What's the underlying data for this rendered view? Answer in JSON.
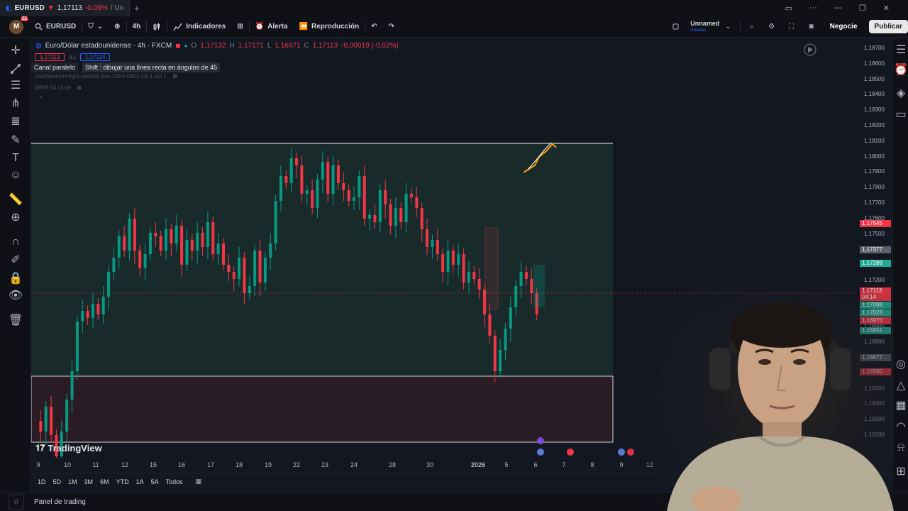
{
  "tab": {
    "symbol": "EURUSD",
    "price": "1,17113",
    "change": "-0.09%",
    "rest": "/ Un"
  },
  "toolbar": {
    "avatar_letter": "M",
    "avatar_badge": "11",
    "symbol": "EURUSD",
    "interval": "4h",
    "indicators_label": "Indicadores",
    "alert_label": "Alerta",
    "replay_label": "Reproducción",
    "layout_name": "Unnamed",
    "layout_status": "Guardar",
    "trade_label": "Negocie",
    "publish_label": "Publicar"
  },
  "legend": {
    "title": "Euro/Dólar estadounidense · 4h · FXCM",
    "o_label": "O",
    "o_value": "1,17132",
    "h_label": "H",
    "h_value": "1,17171",
    "l_label": "L",
    "l_value": "1,16971",
    "c_label": "C",
    "c_value": "1,17113",
    "change": "-0,00019 (-0,02%)",
    "sell_price": "1,17113",
    "spread": "0,1",
    "buy_price": "1,17114",
    "indicator_1": "AsiaSessionHighLowMidLines 0300-0800 sol 1 sol 1",
    "indicator_2": "WMA 14 close"
  },
  "tooltip": {
    "tool_name": "Canal paralelo",
    "hint": "Shift : dibujar una línea recta en ángulos de 45"
  },
  "price_axis": {
    "ticks": [
      "1,18700",
      "1,18600",
      "1,18500",
      "1,18400",
      "1,18300",
      "1,18200",
      "1,18100",
      "1,18000",
      "1,17900",
      "1,17800",
      "1,17700",
      "1,17600",
      "1,17500",
      "1,17400",
      "1,17300",
      "1,17200",
      "1,17100",
      "1,17000",
      "1,16900",
      "1,16800",
      "1,16700",
      "1,16600",
      "1,16500",
      "1,16400",
      "1,16300",
      "1,16200"
    ],
    "labels": [
      {
        "text": "1,17545",
        "color": "#f23645"
      },
      {
        "text": "1,17377",
        "color": "#5d606b"
      },
      {
        "text": "1,17289",
        "color": "#22ab94"
      },
      {
        "text": "1,17113",
        "color": "#f23645"
      },
      {
        "text": "04:14",
        "color": "#f23645"
      },
      {
        "text": "1,17098",
        "color": "#22ab94"
      },
      {
        "text": "1,17026",
        "color": "#22ab94"
      },
      {
        "text": "1,16970",
        "color": "#f23645"
      },
      {
        "text": "1,16851",
        "color": "#22ab94"
      },
      {
        "text": "1,16677",
        "color": "#5d606b"
      },
      {
        "text": "1,16590",
        "color": "#f23645"
      }
    ]
  },
  "time_axis": [
    "9",
    "10",
    "11",
    "12",
    "15",
    "16",
    "17",
    "18",
    "19",
    "22",
    "23",
    "24",
    "28",
    "30",
    "2026",
    "5",
    "6",
    "7",
    "8",
    "9",
    "12"
  ],
  "ranges": [
    "1D",
    "5D",
    "1M",
    "3M",
    "6M",
    "YTD",
    "1A",
    "5A",
    "Todos"
  ],
  "bottom": {
    "panel_label": "Panel de trading"
  },
  "logo": "TradingView"
}
